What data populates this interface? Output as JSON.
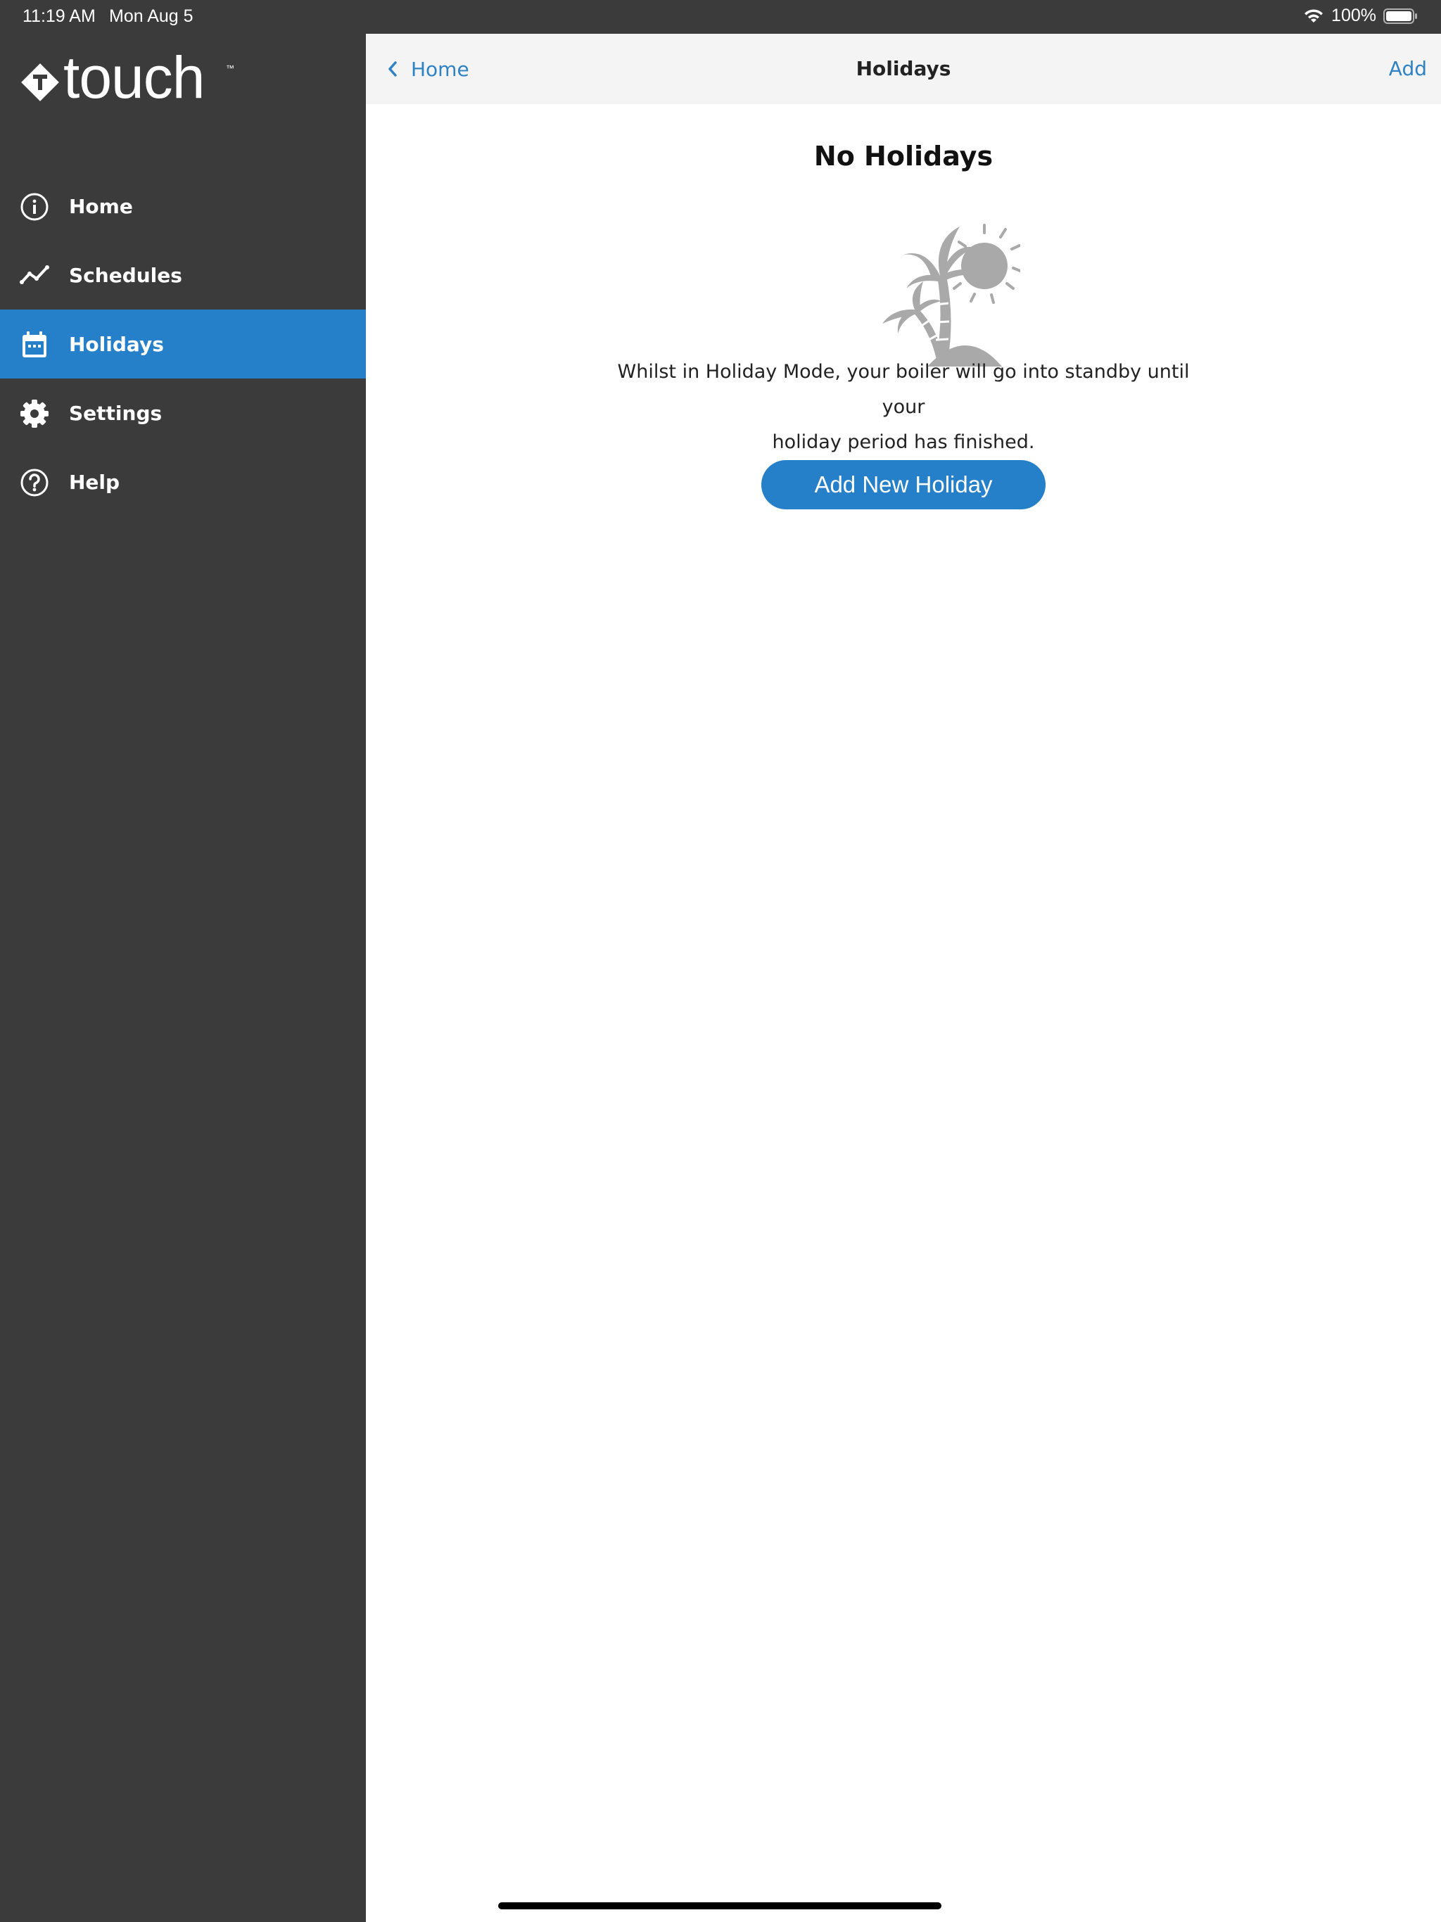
{
  "status_bar": {
    "time": "11:19 AM",
    "date": "Mon Aug 5",
    "battery": "100%",
    "icons": [
      "wifi-icon",
      "battery-icon"
    ]
  },
  "sidebar": {
    "logo_text": "touch",
    "logo_tm": "™",
    "items": [
      {
        "label": "Home",
        "icon": "info-icon",
        "active": false
      },
      {
        "label": "Schedules",
        "icon": "trend-icon",
        "active": false
      },
      {
        "label": "Holidays",
        "icon": "calendar-icon",
        "active": true
      },
      {
        "label": "Settings",
        "icon": "gear-icon",
        "active": false
      },
      {
        "label": "Help",
        "icon": "question-icon",
        "active": false
      }
    ]
  },
  "navbar": {
    "back_label": "Home",
    "title": "Holidays",
    "add_label": "Add"
  },
  "empty_state": {
    "title": "No Holidays",
    "illustration": "palm-tree-sun-icon",
    "description_line1": "Whilst in Holiday Mode, your boiler will go into standby until your",
    "description_line2": "holiday period has finished.",
    "button_label": "Add New Holiday"
  },
  "colors": {
    "sidebar_bg": "#3b3b3b",
    "accent": "#2580c9",
    "link": "#2f83c4",
    "illustration_gray": "#a9a9a9"
  }
}
